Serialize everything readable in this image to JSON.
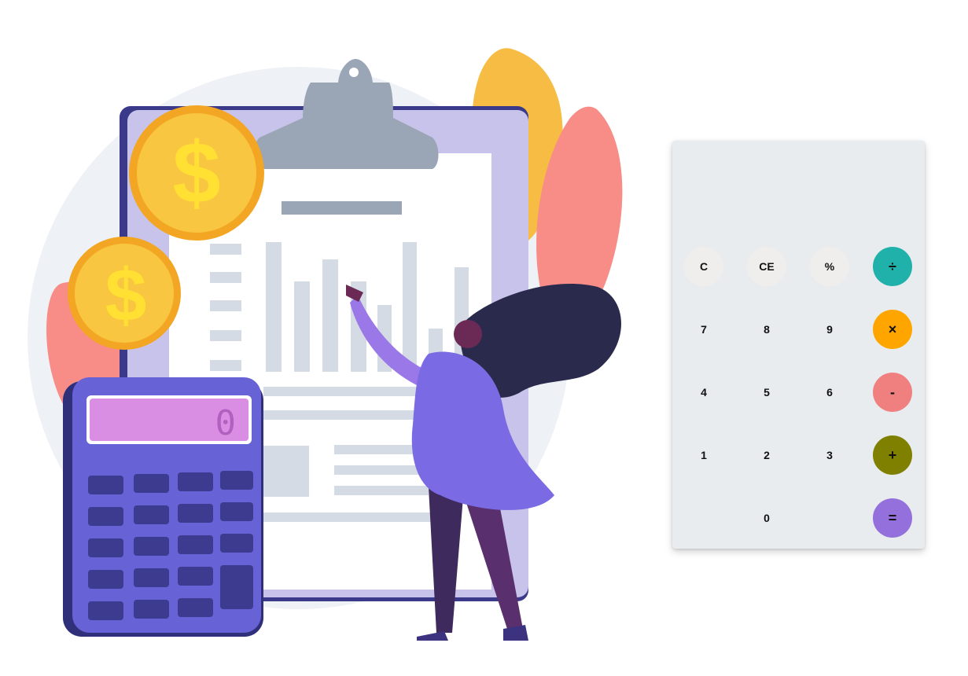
{
  "calculator": {
    "display": "",
    "buttons": {
      "clear": "C",
      "clear_entry": "CE",
      "percent": "%",
      "divide": "÷",
      "seven": "7",
      "eight": "8",
      "nine": "9",
      "multiply": "×",
      "four": "4",
      "five": "5",
      "six": "6",
      "subtract": "-",
      "one": "1",
      "two": "2",
      "three": "3",
      "add": "+",
      "zero": "0",
      "equals": "="
    },
    "colors": {
      "panel": "#e9ecef",
      "function_key": "#efeeec",
      "divide": "#20b2aa",
      "multiply": "#ffa500",
      "subtract": "#f08080",
      "add": "#808000",
      "equals": "#9370db"
    }
  },
  "illustration": {
    "calculator_display": "0",
    "coin_symbol": "$"
  }
}
